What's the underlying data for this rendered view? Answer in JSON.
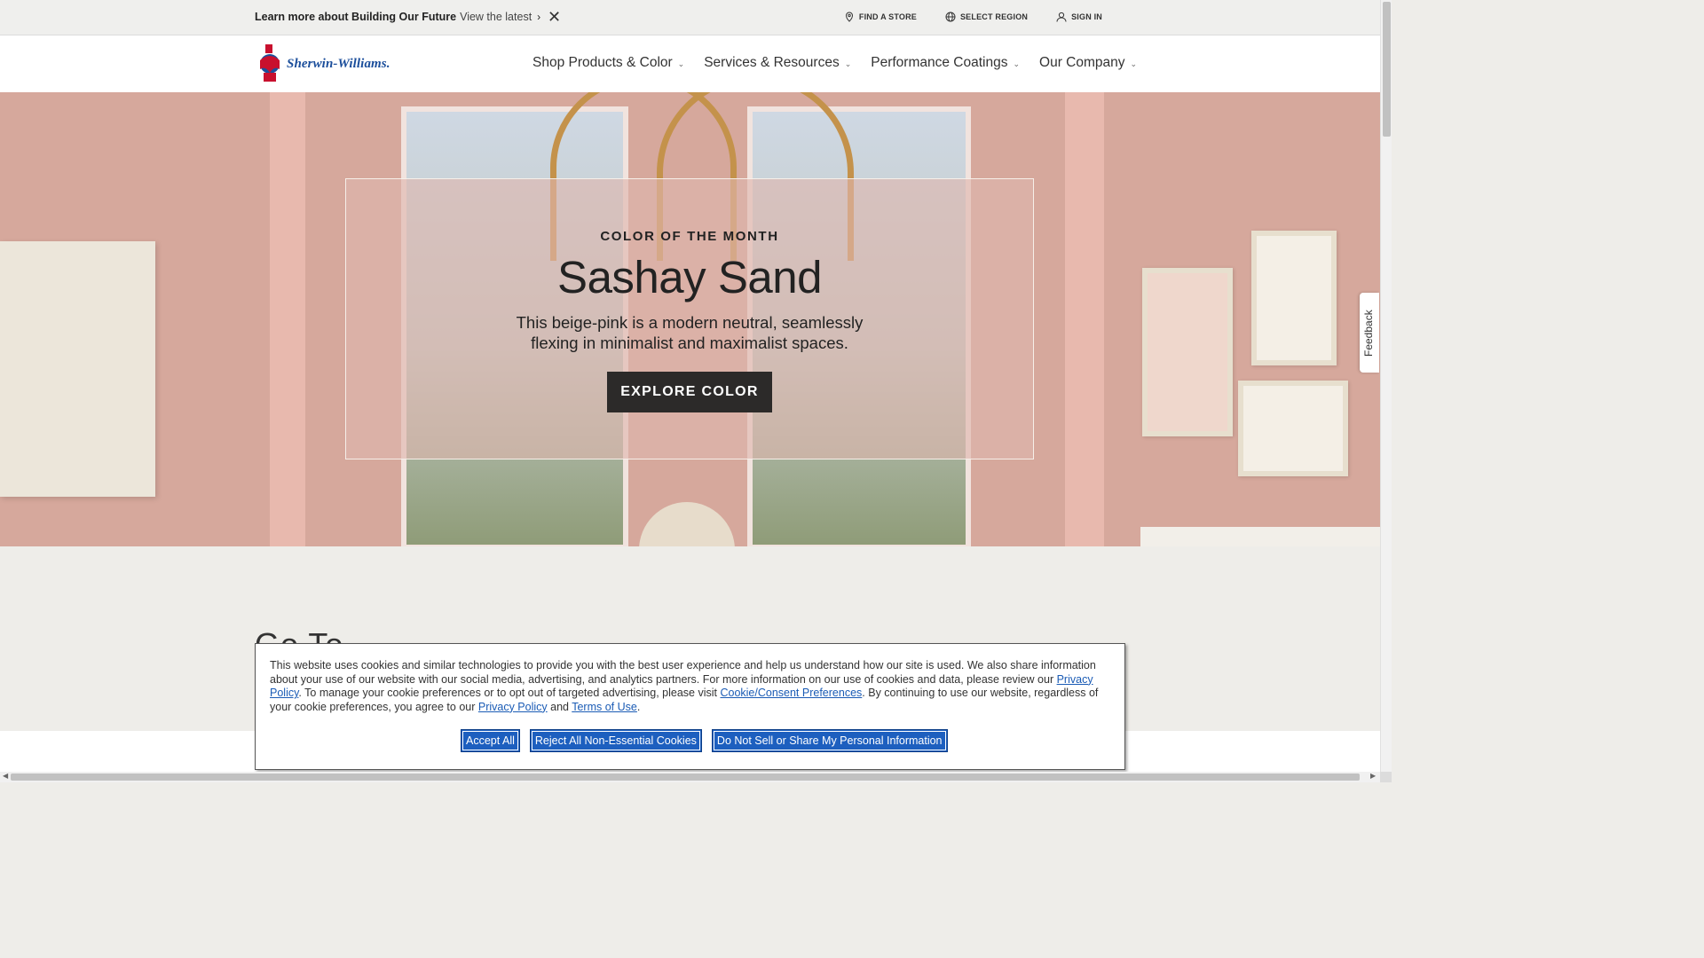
{
  "promo": {
    "bold": "Learn more about Building Our Future",
    "link": "View the latest"
  },
  "utility": {
    "find_store": "FIND A STORE",
    "select_region": "SELECT REGION",
    "sign_in": "SIGN IN"
  },
  "brand": {
    "name": "Sherwin-Williams."
  },
  "nav": {
    "items": [
      {
        "label": "Shop Products & Color"
      },
      {
        "label": "Services & Resources"
      },
      {
        "label": "Performance Coatings"
      },
      {
        "label": "Our Company"
      }
    ]
  },
  "hero": {
    "eyebrow": "COLOR OF THE MONTH",
    "title": "Sashay Sand",
    "description": "This beige-pink is a modern neutral, seamlessly flexing in minimalist and maximalist spaces.",
    "button": "EXPLORE COLOR"
  },
  "feedback": {
    "label": "Feedback"
  },
  "section": {
    "heading": "Go To"
  },
  "cookie": {
    "text_1": "This website uses cookies and similar technologies to provide you with the best user experience and help us understand how our site is used. We also share information about your use of our website with our social media, advertising, and analytics partners. For more information on our use of cookies and data, please review our ",
    "link_privacy_1": "Privacy Policy",
    "text_2": ". To manage your cookie preferences or to opt out of targeted advertising, please visit ",
    "link_prefs": "Cookie/Consent Preferences",
    "text_3": ". By continuing to use our website, regardless of your cookie preferences, you agree to our ",
    "link_privacy_2": "Privacy Policy",
    "text_4": " and ",
    "link_terms": "Terms of Use",
    "text_5": ".",
    "accept": "Accept All",
    "reject": "Reject All Non-Essential Cookies",
    "do_not_sell": "Do Not Sell or Share My Personal Information"
  },
  "colors": {
    "accent": "#1d5fbf",
    "brand": "#1b4e9b",
    "hero_bg": "#d6a89c",
    "button_dark": "#2c2a29"
  }
}
